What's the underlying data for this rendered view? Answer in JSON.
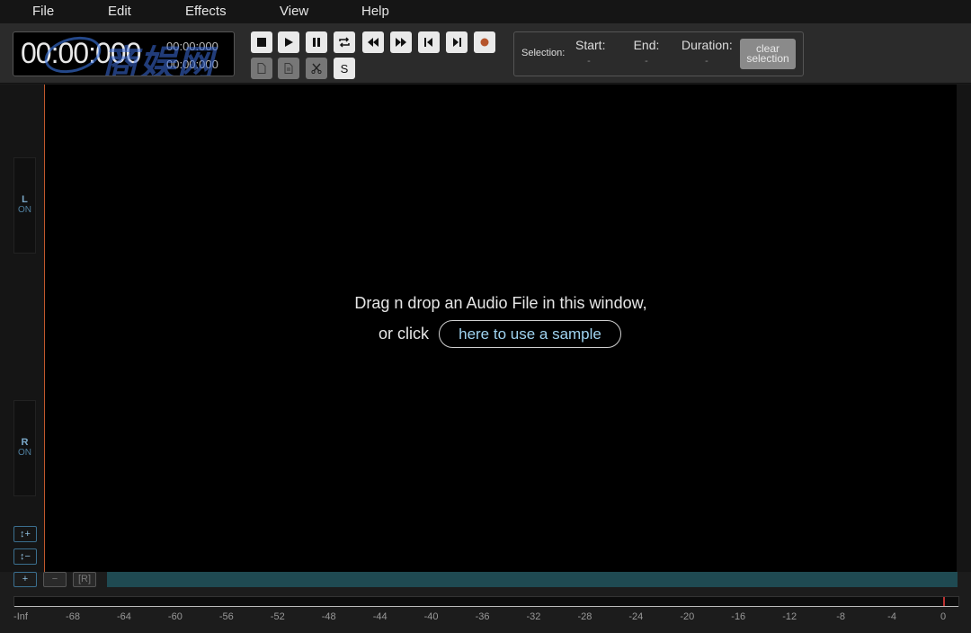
{
  "menu": {
    "file": "File",
    "edit": "Edit",
    "effects": "Effects",
    "view": "View",
    "help": "Help"
  },
  "time": {
    "main": "00:00:000",
    "sub1": "00:00:000",
    "sub2": "00:00:000",
    "watermark": "商娱网"
  },
  "transport": {
    "stop_icon": "stop-icon",
    "play_icon": "play-icon",
    "pause_icon": "pause-icon",
    "loop_icon": "loop-icon",
    "rewind_icon": "rewind-icon",
    "forward_icon": "fast-forward-icon",
    "skip_start_icon": "skip-to-start-icon",
    "skip_end_icon": "skip-to-end-icon",
    "record_icon": "record-icon",
    "record_color": "#b5532a",
    "s_label": "S"
  },
  "selection": {
    "label": "Selection:",
    "start_label": "Start:",
    "start_value": "-",
    "end_label": "End:",
    "end_value": "-",
    "duration_label": "Duration:",
    "duration_value": "-",
    "clear_line1": "clear",
    "clear_line2": "selection"
  },
  "channels": {
    "left_name": "L",
    "left_state": "ON",
    "right_name": "R",
    "right_state": "ON"
  },
  "zoom": {
    "v_in": "↕+",
    "v_out": "↕−",
    "h_in": "+",
    "h_out": "−",
    "reset": "[R]"
  },
  "drop": {
    "line1": "Drag n drop an Audio File in this window,",
    "or_click": "or click",
    "sample_link": "here to use a sample"
  },
  "meter": {
    "ticks": [
      "-Inf",
      "-68",
      "-64",
      "-60",
      "-56",
      "-52",
      "-48",
      "-44",
      "-40",
      "-36",
      "-32",
      "-28",
      "-24",
      "-20",
      "-16",
      "-12",
      "-8",
      "-4",
      "0"
    ]
  },
  "colors": {
    "accent": "#9fd3f0",
    "cursor": "#c0582c",
    "scrollbar": "#1f4a52"
  }
}
